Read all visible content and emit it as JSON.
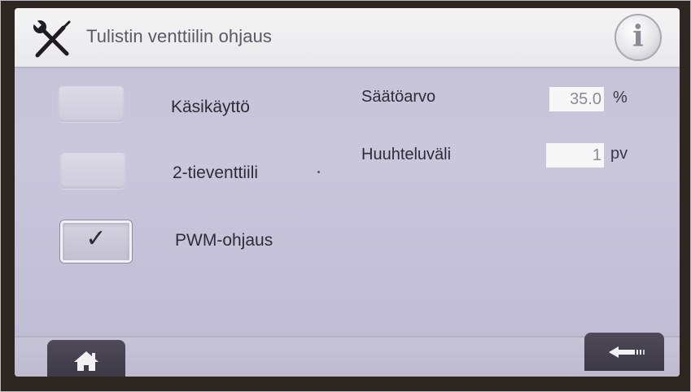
{
  "header": {
    "title": "Tulistin venttiilin ohjaus",
    "tools_icon": "wrench-screwdriver-icon",
    "info_icon": "info-icon",
    "info_glyph": "i"
  },
  "options": [
    {
      "label": "Käsikäyttö",
      "checked": false
    },
    {
      "label": "2-tieventtiili",
      "checked": false
    },
    {
      "label": "PWM-ohjaus",
      "checked": true,
      "mark": "✓"
    }
  ],
  "parameters": [
    {
      "label": "Säätöarvo",
      "value": "35.0",
      "unit": "%"
    },
    {
      "label": "Huuhteluväli",
      "value": "1",
      "unit": "pv"
    }
  ],
  "footer": {
    "home_icon": "home-icon",
    "back_icon": "back-arrow-icon"
  },
  "colors": {
    "screen_bg": "#c4c0d6",
    "titlebar_bg": "#f1f1f3",
    "footer_button": "#46424f",
    "text": "#2e2c36"
  }
}
